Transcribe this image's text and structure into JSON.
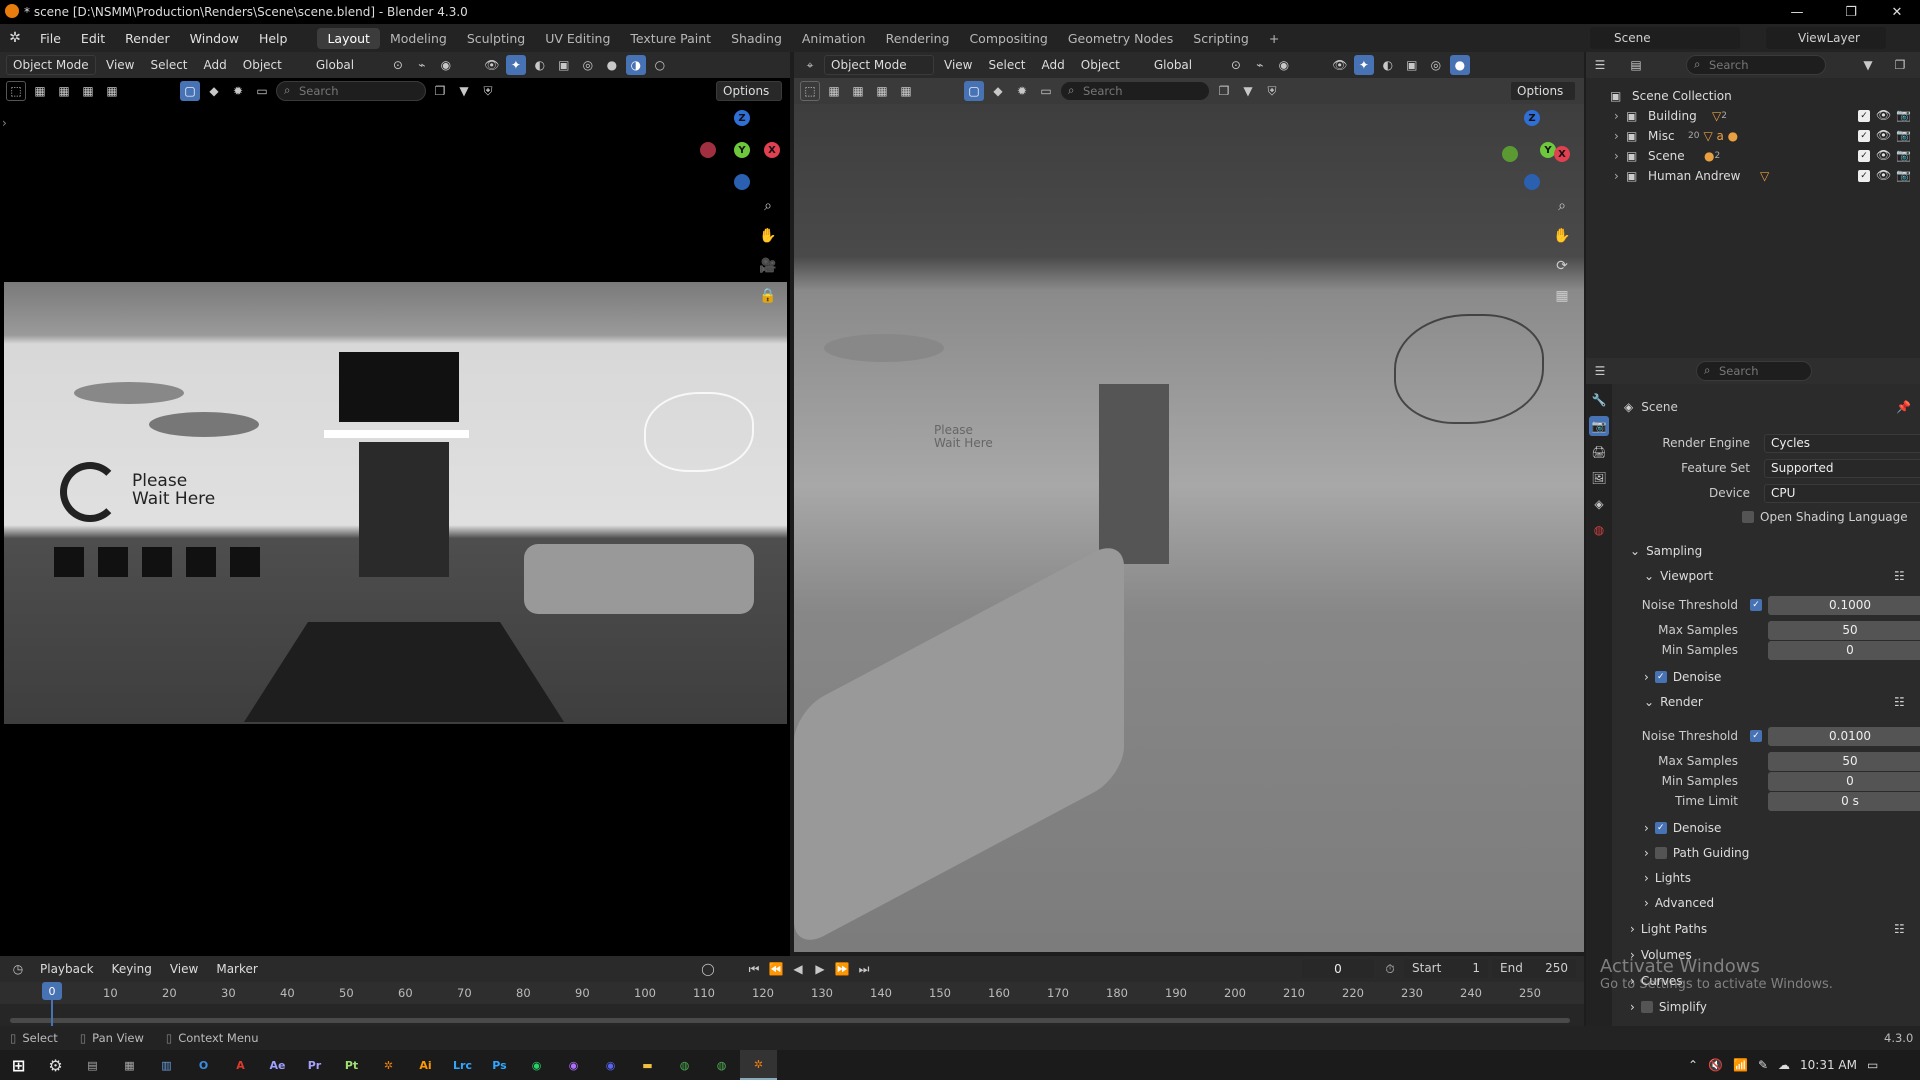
{
  "window": {
    "title": "* scene [D:\\NSMM\\Production\\Renders\\Scene\\scene.blend] - Blender 4.3.0"
  },
  "menu": {
    "file": "File",
    "edit": "Edit",
    "render": "Render",
    "window": "Window",
    "help": "Help"
  },
  "workspaces": [
    "Layout",
    "Modeling",
    "Sculpting",
    "UV Editing",
    "Texture Paint",
    "Shading",
    "Animation",
    "Rendering",
    "Compositing",
    "Geometry Nodes",
    "Scripting"
  ],
  "viewport_left": {
    "mode": "Object Mode",
    "view": "View",
    "select": "Select",
    "add": "Add",
    "object": "Object",
    "orientation": "Global",
    "search_placeholder": "Search",
    "options": "Options",
    "wall_text_line1": "Please",
    "wall_text_line2": "Wait Here"
  },
  "viewport_right": {
    "mode": "Object Mode",
    "view": "View",
    "select": "Select",
    "add": "Add",
    "object": "Object",
    "orientation": "Global",
    "search_placeholder": "Search",
    "options": "Options",
    "wall_text_line1": "Please",
    "wall_text_line2": "Wait Here"
  },
  "gizmo": {
    "z": "Z",
    "y": "Y",
    "x": "X"
  },
  "outliner": {
    "scene_label": "Scene",
    "viewlayer_label": "ViewLayer",
    "search_placeholder": "Search",
    "root": "Scene Collection",
    "items": [
      {
        "name": "Building",
        "badge": "2"
      },
      {
        "name": "Misc",
        "badge": "20"
      },
      {
        "name": "Scene",
        "badge": "2"
      },
      {
        "name": "Human Andrew",
        "badge": ""
      }
    ]
  },
  "properties": {
    "search_placeholder": "Search",
    "context": "Scene",
    "render_engine_label": "Render Engine",
    "render_engine": "Cycles",
    "feature_set_label": "Feature Set",
    "feature_set": "Supported",
    "device_label": "Device",
    "device": "CPU",
    "osl_label": "Open Shading Language",
    "sampling": "Sampling",
    "viewport": "Viewport",
    "noise_threshold_label": "Noise Threshold",
    "vp_noise": "0.1000",
    "max_samples_label": "Max Samples",
    "vp_max": "50",
    "min_samples_label": "Min Samples",
    "vp_min": "0",
    "denoise_label": "Denoise",
    "render": "Render",
    "r_noise": "0.0100",
    "r_max": "50",
    "r_min": "0",
    "time_limit_label": "Time Limit",
    "r_time": "0 s",
    "path_guiding": "Path Guiding",
    "lights": "Lights",
    "advanced": "Advanced",
    "light_paths": "Light Paths",
    "volumes": "Volumes",
    "curves": "Curves",
    "simplify": "Simplify",
    "watermark1": "Activate Windows",
    "watermark2": "Go to Settings to activate Windows."
  },
  "timeline": {
    "playback": "Playback",
    "keying": "Keying",
    "view": "View",
    "marker": "Marker",
    "current": "0",
    "start_label": "Start",
    "start": "1",
    "end_label": "End",
    "end": "250",
    "ticks": [
      "0",
      "10",
      "20",
      "30",
      "40",
      "50",
      "60",
      "70",
      "80",
      "90",
      "100",
      "110",
      "120",
      "130",
      "140",
      "150",
      "160",
      "170",
      "180",
      "190",
      "200",
      "210",
      "220",
      "230",
      "240",
      "250"
    ]
  },
  "statusbar": {
    "select": "Select",
    "pan": "Pan View",
    "context": "Context Menu",
    "version": "4.3.0"
  },
  "taskbar": {
    "apps": [
      "Ae",
      "Pr",
      "Pt",
      "Ai",
      "Lrc",
      "Ps"
    ],
    "time": "10:31 AM"
  }
}
